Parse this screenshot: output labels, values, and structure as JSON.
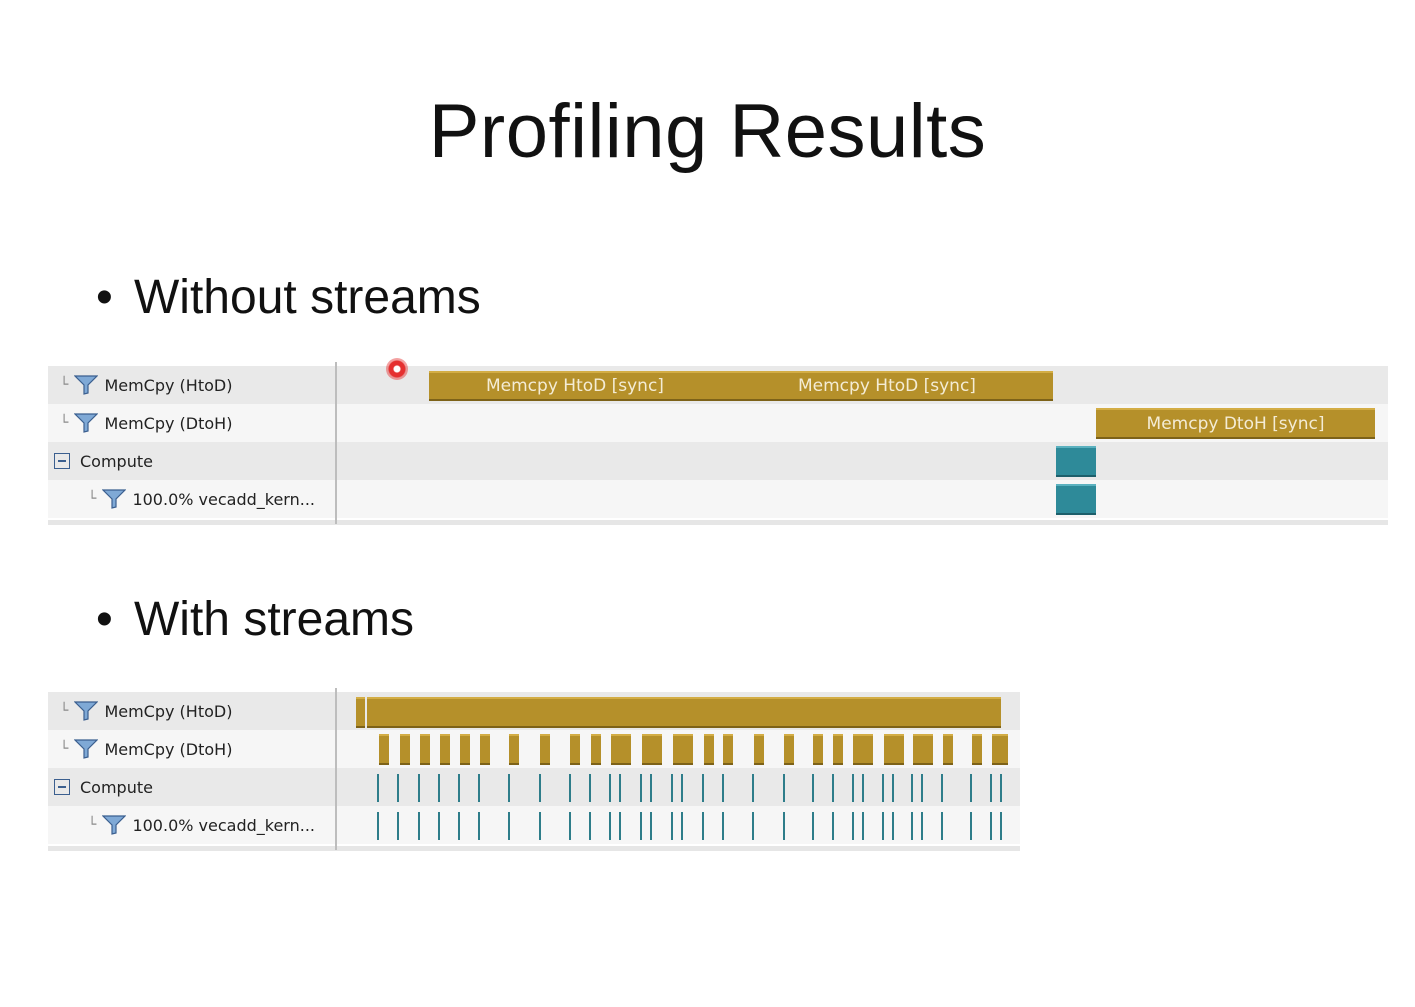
{
  "slide": {
    "title": "Profiling Results",
    "bullet_without": "Without streams",
    "bullet_with": "With streams",
    "bullet_glyph": "•"
  },
  "timeline_labels": {
    "htod": "MemCpy (HtoD)",
    "dtoh": "MemCpy (DtoH)",
    "compute": "Compute",
    "kernel": "100.0% vecadd_kern..."
  },
  "without_streams": {
    "htod_bar_1": "Memcpy HtoD [sync]",
    "htod_bar_2": "Memcpy HtoD [sync]",
    "dtoh_bar": "Memcpy DtoH [sync]"
  },
  "colors": {
    "memcpy": "#b5902a",
    "kernel": "#2e8a99",
    "row_alt": "#e9e9e9",
    "row_base": "#f6f6f6"
  },
  "icons": {
    "filter": "funnel-icon",
    "collapse": "minus-box-icon",
    "tree": "tree-branch-icon"
  }
}
